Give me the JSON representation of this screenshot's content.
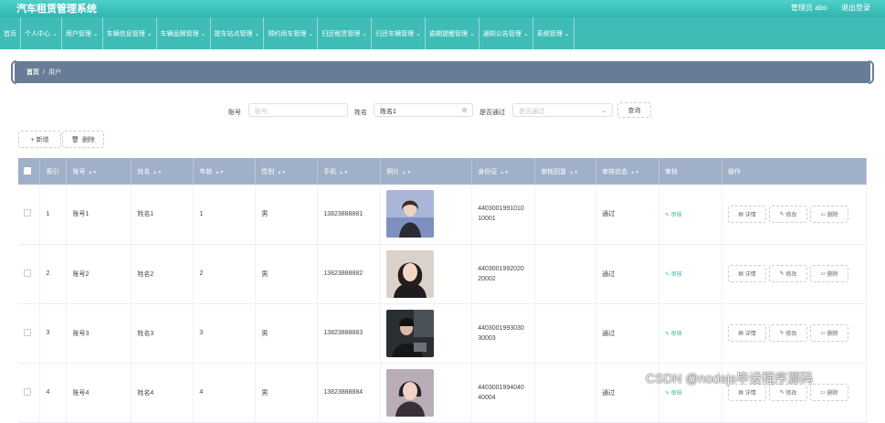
{
  "app": {
    "title": "汽车租赁管理系统",
    "admin": "管理员 abo",
    "logout": "退出登录"
  },
  "nav": [
    {
      "label": "首页",
      "dropdown": false
    },
    {
      "label": "个人中心",
      "dropdown": true
    },
    {
      "label": "用户管理",
      "dropdown": true
    },
    {
      "label": "车辆信息管理",
      "dropdown": true
    },
    {
      "label": "车辆品牌管理",
      "dropdown": true
    },
    {
      "label": "提车站点管理",
      "dropdown": true
    },
    {
      "label": "预约用车管理",
      "dropdown": true
    },
    {
      "label": "归还租赁管理",
      "dropdown": true
    },
    {
      "label": "归还车辆管理",
      "dropdown": true
    },
    {
      "label": "逾期提醒管理",
      "dropdown": true
    },
    {
      "label": "通知公告管理",
      "dropdown": true
    },
    {
      "label": "系统管理",
      "dropdown": true
    }
  ],
  "breadcrumb": {
    "home": "首页",
    "separator": "/",
    "current": "用户"
  },
  "search": {
    "account_label": "账号",
    "account_placeholder": "账号",
    "name_label": "姓名",
    "name_value": "姓名1",
    "approved_label": "是否通过",
    "approved_placeholder": "是否通过",
    "query_button": "查询"
  },
  "actions": {
    "add": "+ 新增",
    "delete": "删除"
  },
  "table": {
    "columns": [
      "索引",
      "账号",
      "姓名",
      "年龄",
      "性别",
      "手机",
      "照片",
      "身份证",
      "审核回复",
      "审核状态",
      "审核",
      "操作"
    ],
    "audit_label": "审核",
    "ops": {
      "detail": "详情",
      "edit": "修改",
      "delete": "删除"
    },
    "rows": [
      {
        "index": "1",
        "account": "账号1",
        "name": "姓名1",
        "age": "1",
        "gender": "男",
        "phone": "13823888881",
        "id1": "4403001991010",
        "id2": "10001",
        "reply": "",
        "status": "通过"
      },
      {
        "index": "2",
        "account": "账号2",
        "name": "姓名2",
        "age": "2",
        "gender": "男",
        "phone": "13823888882",
        "id1": "4403001992020",
        "id2": "20002",
        "reply": "",
        "status": "通过"
      },
      {
        "index": "3",
        "account": "账号3",
        "name": "姓名3",
        "age": "3",
        "gender": "男",
        "phone": "13823888883",
        "id1": "4403001993030",
        "id2": "30003",
        "reply": "",
        "status": "通过"
      },
      {
        "index": "4",
        "account": "账号4",
        "name": "姓名4",
        "age": "4",
        "gender": "男",
        "phone": "13823888884",
        "id1": "4403001994040",
        "id2": "40004",
        "reply": "",
        "status": "通过"
      }
    ]
  },
  "watermark": "CSDN @nodejs毕设程序源码",
  "colors": {
    "header": "#3fbcb6",
    "breadcrumb": "#687c98",
    "table_header": "#9fb0c8",
    "audit": "#3bb6a8"
  }
}
